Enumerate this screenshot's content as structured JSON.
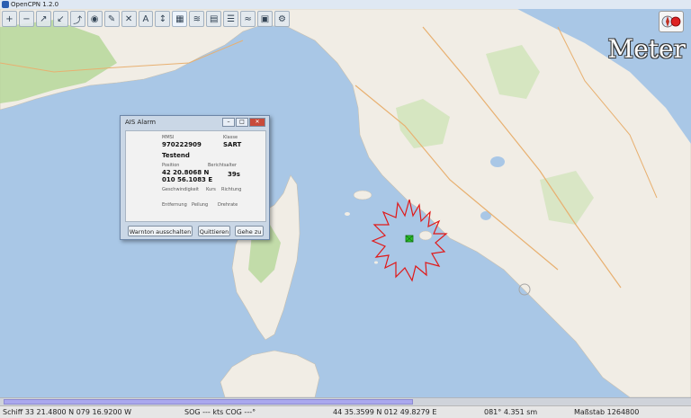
{
  "window": {
    "title": "OpenCPN 1.2.0"
  },
  "toolbar": {
    "buttons": [
      {
        "name": "zoom-in-icon",
        "glyph": "+"
      },
      {
        "name": "zoom-out-icon",
        "glyph": "−"
      },
      {
        "name": "scale-in-icon",
        "glyph": "↗"
      },
      {
        "name": "scale-out-icon",
        "glyph": "↙"
      },
      {
        "name": "route-icon",
        "glyph": "⤴"
      },
      {
        "name": "ship-follow-icon",
        "glyph": "◉"
      },
      {
        "name": "pen-icon",
        "glyph": "✎"
      },
      {
        "name": "settings-icon",
        "glyph": "✕"
      },
      {
        "name": "text-icon",
        "glyph": "A"
      },
      {
        "name": "current-icon",
        "glyph": "↕"
      },
      {
        "name": "chart-icon",
        "glyph": "▦"
      },
      {
        "name": "tide-icon",
        "glyph": "≋"
      },
      {
        "name": "print-icon",
        "glyph": "▤"
      },
      {
        "name": "route-manager-icon",
        "glyph": "☰"
      },
      {
        "name": "track-icon",
        "glyph": "≈"
      },
      {
        "name": "ais-icon",
        "glyph": "▣"
      },
      {
        "name": "gear-icon",
        "glyph": "⚙"
      },
      {
        "name": "help-icon",
        "glyph": "▥"
      }
    ]
  },
  "overlay": {
    "unit_label": "Meter"
  },
  "ais_alarm": {
    "title": "AIS Alarm",
    "mmsi_label": "MMSI",
    "mmsi_value": "970222909",
    "class_label": "Klasse",
    "class_value": "SART",
    "name_value": "Testend",
    "position_label": "Position",
    "lat_value": "42 20.8068 N",
    "lon_value": "010 56.1083 E",
    "age_label": "Berichtsalter",
    "age_value": "39s",
    "speed_label": "Geschwindigkeit",
    "course_label": "Kurs",
    "heading_label": "Richtung",
    "distance_label": "Entfernung",
    "bearing_label": "Peilung",
    "rate_label": "Drehrate",
    "btn_silence": "Warnton ausschalten",
    "btn_ack": "Quittieren",
    "btn_goto": "Gehe zu"
  },
  "status": {
    "ship": "Schiff 33 21.4800 N   079 16.9200 W",
    "sog": "SOG --- kts  COG ---°",
    "cursor": "44 35.3599 N   012 49.8279 E",
    "bearing": "081°  4.351 sm",
    "scale": "Maßstab 1264800"
  },
  "colors": {
    "sea": "#a9c7e6",
    "land": "#f1ede5",
    "sart_ring": "#e01818",
    "target": "#2cc02c"
  }
}
